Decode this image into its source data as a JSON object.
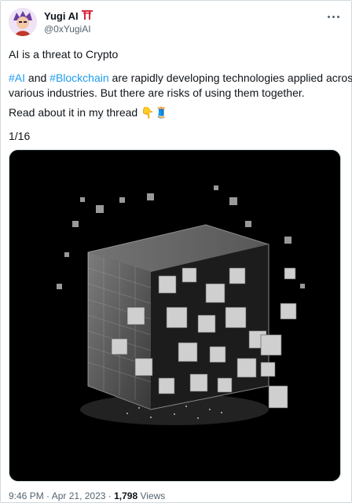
{
  "author": {
    "name": "Yugi AI",
    "name_emoji": "⛩",
    "handle": "@0xYugiAI"
  },
  "tweet": {
    "line1": "AI is a threat to Crypto",
    "para2": {
      "tag1": "#AI",
      "word_and": " and ",
      "tag2": "#Blockchain",
      "rest_line1": " are rapidly developing technologies applied across",
      "line2": "various industries. But there are risks of using them together."
    },
    "line3_text": "Read about it in my thread ",
    "line3_emoji": "👇🧵",
    "counter": "1/16"
  },
  "meta": {
    "time": "9:46 PM",
    "sep": " · ",
    "date": "Apr 21, 2023",
    "sep2": " · ",
    "views_count": "1,798",
    "views_label": " Views"
  },
  "colors": {
    "link": "#1d9bf0",
    "text": "#0f1419",
    "muted": "#536471",
    "border": "#cfd9de"
  },
  "icons": [
    "avatar",
    "torii-icon",
    "more-icon"
  ]
}
